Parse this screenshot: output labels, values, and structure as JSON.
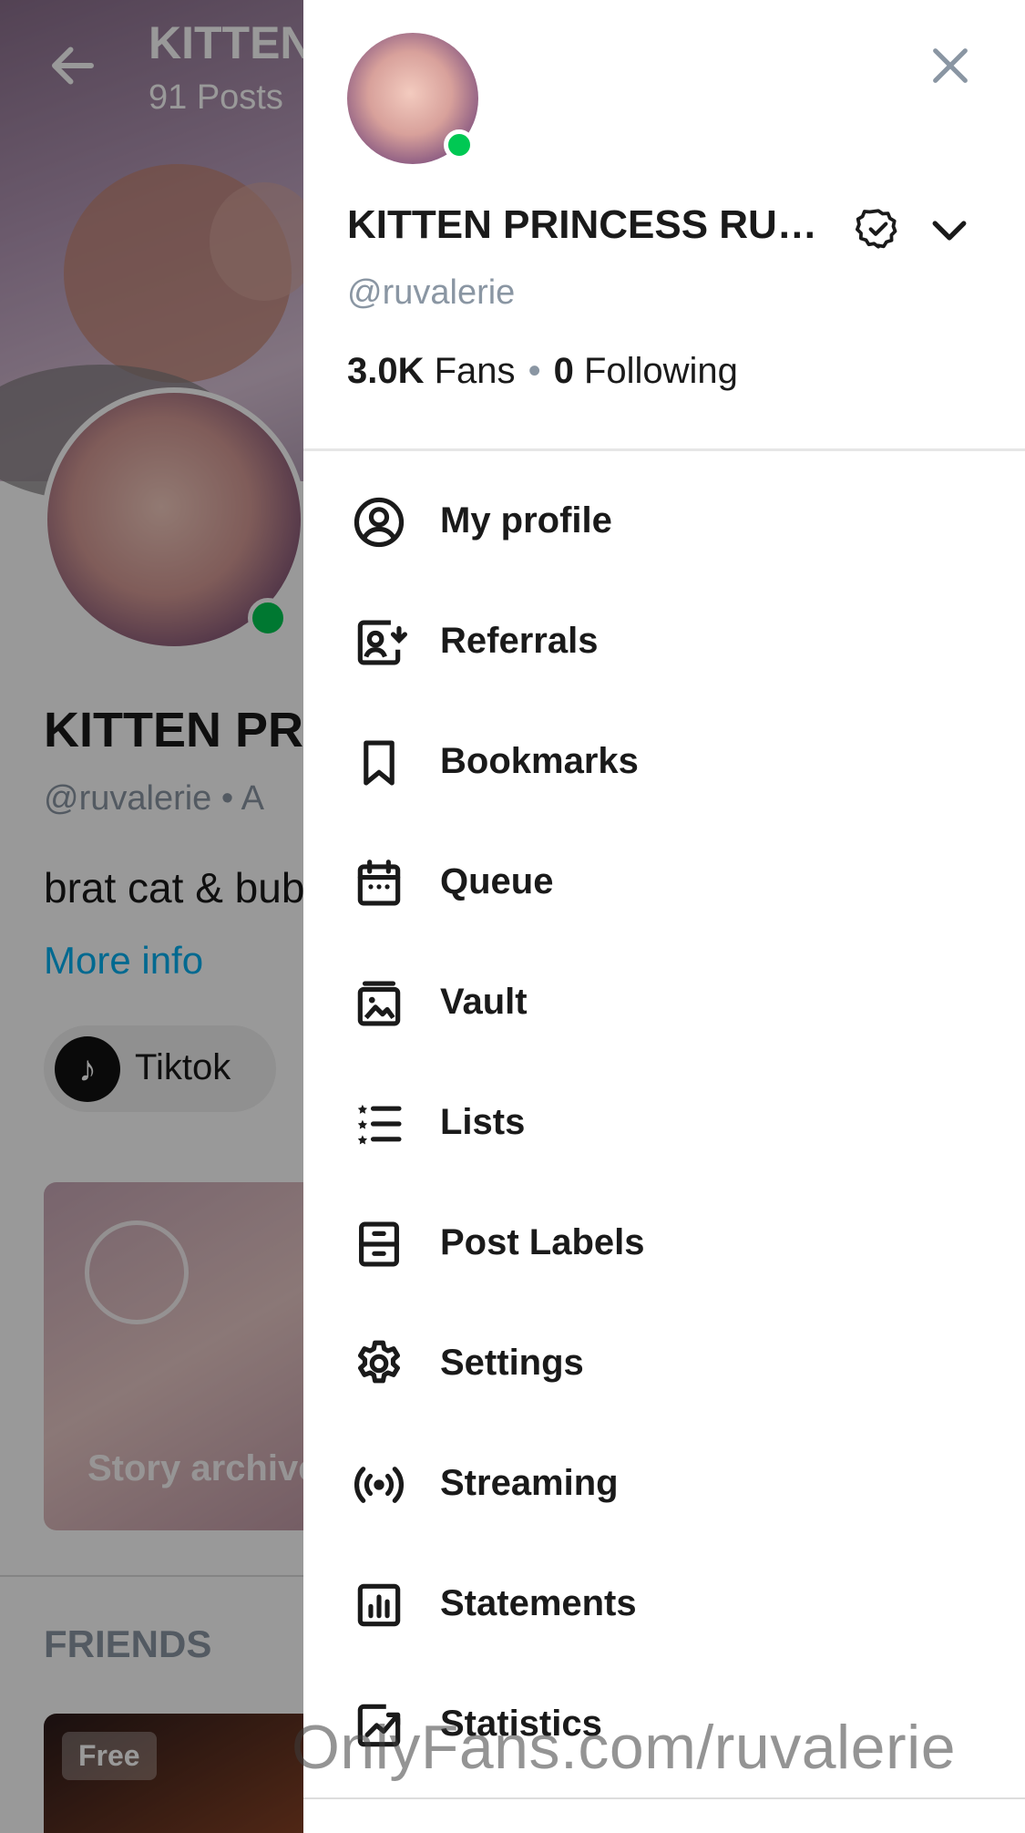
{
  "background_profile": {
    "header_title": "KITTEN",
    "header_posts": "91 Posts",
    "name": "KITTEN PRI",
    "handle": "@ruvalerie  •  A",
    "bio": "brat cat & bub",
    "more_info": "More info",
    "social_chip": {
      "label": "Tiktok",
      "icon": "tiktok-icon"
    },
    "story_archive": "Story archive",
    "friends_heading": "FRIENDS",
    "free_badge": "Free"
  },
  "drawer": {
    "name": "KITTEN PRINCESS RU …",
    "handle": "@ruvalerie",
    "fans_count": "3.0K",
    "fans_label": "Fans",
    "following_count": "0",
    "following_label": "Following",
    "separator": "•",
    "online_color": "#00c853",
    "menu": [
      {
        "label": "My profile",
        "icon": "user-circle-icon"
      },
      {
        "label": "Referrals",
        "icon": "referral-icon"
      },
      {
        "label": "Bookmarks",
        "icon": "bookmark-icon"
      },
      {
        "label": "Queue",
        "icon": "calendar-icon"
      },
      {
        "label": "Vault",
        "icon": "vault-image-icon"
      },
      {
        "label": "Lists",
        "icon": "list-stars-icon"
      },
      {
        "label": "Post Labels",
        "icon": "drawer-icon"
      },
      {
        "label": "Settings",
        "icon": "gear-icon"
      },
      {
        "label": "Streaming",
        "icon": "broadcast-icon"
      },
      {
        "label": "Statements",
        "icon": "bar-chart-icon"
      },
      {
        "label": "Statistics",
        "icon": "trend-chart-icon"
      }
    ]
  },
  "watermark": "OnlyFans.com/ruvalerie",
  "colors": {
    "accent": "#00aff0",
    "muted": "#8a96a3",
    "text": "#1a1a1a"
  }
}
